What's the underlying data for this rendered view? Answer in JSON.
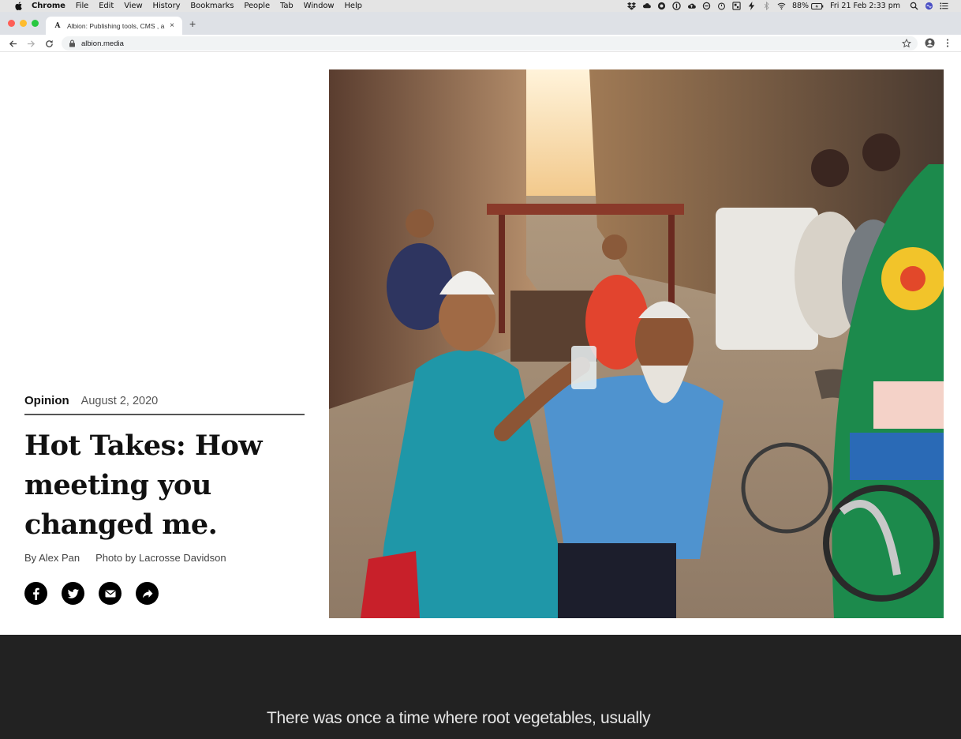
{
  "menubar": {
    "items": [
      "Chrome",
      "File",
      "Edit",
      "View",
      "History",
      "Bookmarks",
      "People",
      "Tab",
      "Window",
      "Help"
    ],
    "battery": "88%",
    "datetime": "Fri 21 Feb  2:33 pm"
  },
  "browser": {
    "tab_title": "Albion: Publishing tools, CMS , a",
    "tab_favicon": "A",
    "new_tab": "+",
    "close_tab": "×",
    "url": "albion.media",
    "traffic_colors": [
      "#fe5f57",
      "#febc2e",
      "#28c840"
    ]
  },
  "article": {
    "category": "Opinion",
    "date": "August 2, 2020",
    "headline": "Hot Takes: How meeting you changed me.",
    "byline": "By Alex Pan",
    "photo_credit": "Photo by Lacrosse Davidson",
    "share_icons": [
      "facebook-icon",
      "twitter-icon",
      "email-icon",
      "share-icon"
    ],
    "lede": "There was once a time where root vegetables, usually"
  }
}
